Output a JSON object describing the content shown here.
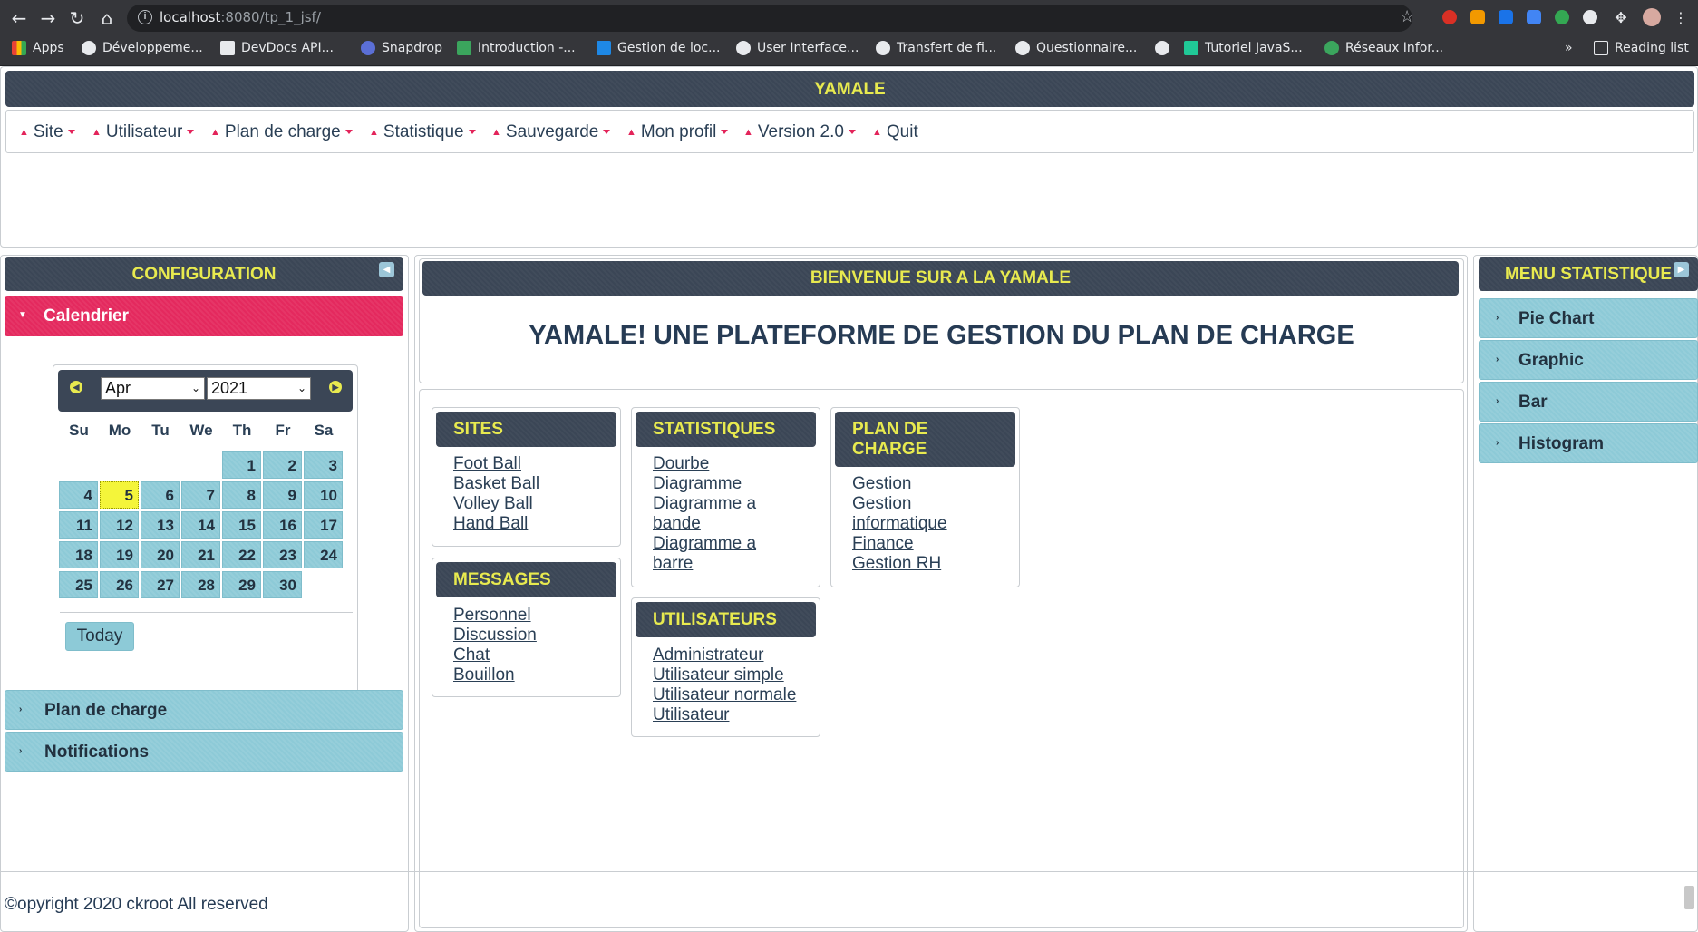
{
  "browser": {
    "url_host": "localhost",
    "url_rest": ":8080/tp_1_jsf/",
    "bookmarks": [
      "Apps",
      "Développeme...",
      "DevDocs API...",
      "Snapdrop",
      "Introduction -...",
      "Gestion de loc...",
      "User Interface...",
      "Transfert de fi...",
      "Questionnaire...",
      "",
      "Tutoriel JavaS...",
      "Réseaux Infor..."
    ],
    "overflow": "»",
    "reading_list": "Reading list"
  },
  "header": {
    "title": "YAMALE",
    "menu": [
      "Site",
      "Utilisateur",
      "Plan de charge",
      "Statistique",
      "Sauvegarde",
      "Mon profil",
      "Version 2.0",
      "Quit"
    ]
  },
  "left": {
    "title": "CONFIGURATION",
    "active_panel": "Calendrier",
    "calendar": {
      "month": "Apr",
      "year": "2021",
      "weekdays": [
        "Su",
        "Mo",
        "Tu",
        "We",
        "Th",
        "Fr",
        "Sa"
      ],
      "days": [
        "1",
        "2",
        "3",
        "4",
        "5",
        "6",
        "7",
        "8",
        "9",
        "10",
        "11",
        "12",
        "13",
        "14",
        "15",
        "16",
        "17",
        "18",
        "19",
        "20",
        "21",
        "22",
        "23",
        "24",
        "25",
        "26",
        "27",
        "28",
        "29",
        "30"
      ],
      "first_weekday": 4,
      "selected_day": 5,
      "today_label": "Today"
    },
    "panels": [
      "Plan de charge",
      "Notifications"
    ]
  },
  "center": {
    "welcome": "BIENVENUE SUR A LA YAMALE",
    "headline": "YAMALE! UNE PLATEFORME DE GESTION DU PLAN DE CHARGE",
    "cards": {
      "sites": {
        "title": "SITES",
        "links": [
          "Foot Ball",
          "Basket Ball",
          "Volley Ball",
          "Hand Ball"
        ]
      },
      "messages": {
        "title": "MESSAGES",
        "links": [
          "Personnel",
          "Discussion",
          "Chat",
          "Bouillon"
        ]
      },
      "statistiques": {
        "title": "STATISTIQUES",
        "links": [
          "Dourbe",
          "Diagramme",
          "Diagramme a",
          "bande",
          "Diagramme a",
          "barre"
        ]
      },
      "utilisateurs": {
        "title": "UTILISATEURS",
        "links": [
          "Administrateur",
          "Utilisateur simple",
          "Utilisateur normale",
          "Utilisateur"
        ]
      },
      "plan": {
        "title": "PLAN DE",
        "title2": "CHARGE",
        "links": [
          "Gestion",
          "Gestion",
          "informatique",
          "Finance",
          "Gestion RH"
        ]
      }
    }
  },
  "right": {
    "title": "MENU STATISTIQUE",
    "items": [
      "Pie Chart",
      "Graphic",
      "Bar",
      "Histogram"
    ]
  },
  "footer": {
    "text": "©opyright 2020 ckroot All reserved"
  },
  "colors": {
    "header_bg": "#3b4656",
    "header_text": "#e8ea4f",
    "accent": "#e4295e",
    "teal": "#8dcad7",
    "today": "#f4f53a"
  }
}
